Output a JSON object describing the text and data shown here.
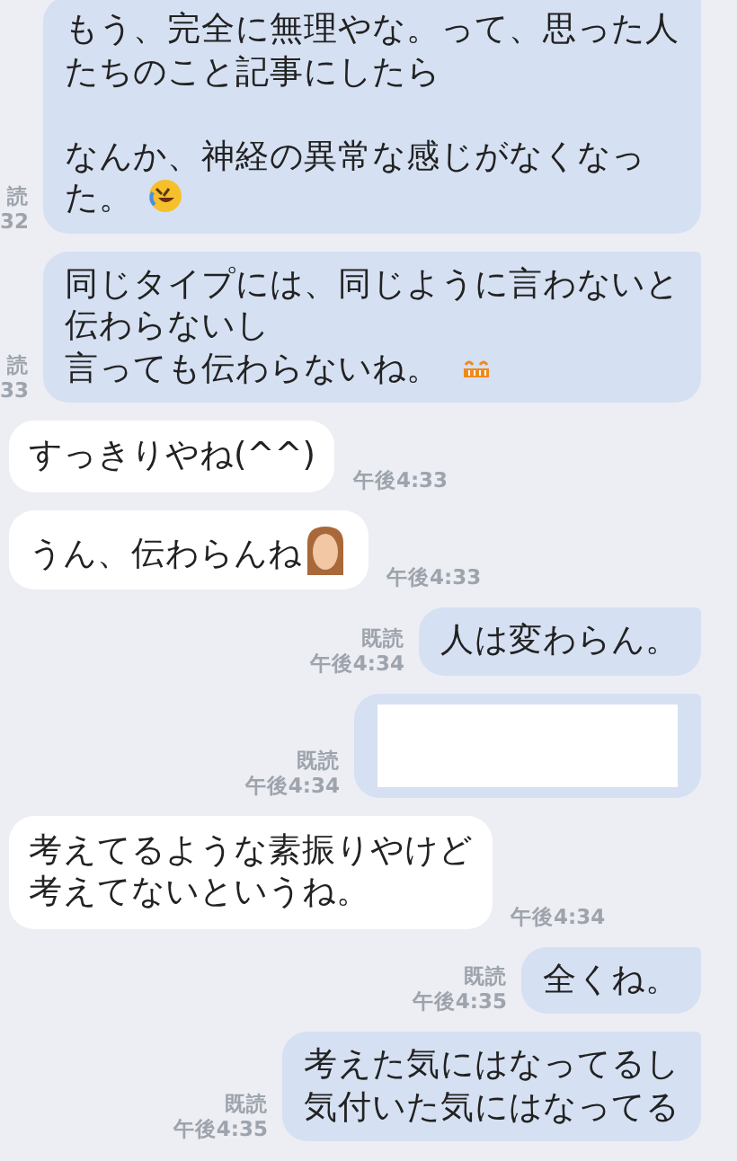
{
  "messages": [
    {
      "kind": "sent",
      "paragraphs": [
        [
          "もう、完全に無理やな。って、思った人",
          "たちのこと記事にしたら"
        ],
        [
          "なんか、神経の異常な感じがなくなっ",
          "た。"
        ]
      ],
      "icon": {
        "kind": "laugh"
      },
      "read": "読",
      "time": "32"
    },
    {
      "kind": "sent",
      "lines": [
        "同じタイプには、同じように言わないと",
        "伝わらないし",
        "言っても伝わらないね。"
      ],
      "icon": {
        "kind": "grin"
      },
      "read": "読",
      "time": "33"
    },
    {
      "kind": "received",
      "lines": [
        "すっきりやね(^^)"
      ],
      "time": "午後4:33"
    },
    {
      "kind": "received",
      "lines": [
        "うん、伝わらんね"
      ],
      "icon": {
        "kind": "sticker"
      },
      "time": "午後4:33"
    },
    {
      "kind": "sent",
      "lines": [
        "人は変わらん。"
      ],
      "read": "既読",
      "time": "午後4:34"
    },
    {
      "kind": "image",
      "read": "既読",
      "time": "午後4:34"
    },
    {
      "kind": "received",
      "lines": [
        "考えてるような素振りやけど",
        "考えてないというね。"
      ],
      "time": "午後4:34"
    },
    {
      "kind": "sent",
      "lines": [
        "全くね。"
      ],
      "read": "既読",
      "time": "午後4:35"
    },
    {
      "kind": "sent",
      "lines": [
        "考えた気にはなってるし",
        "気付いた気にはなってる"
      ],
      "read": "既読",
      "time": "午後4:35"
    }
  ]
}
